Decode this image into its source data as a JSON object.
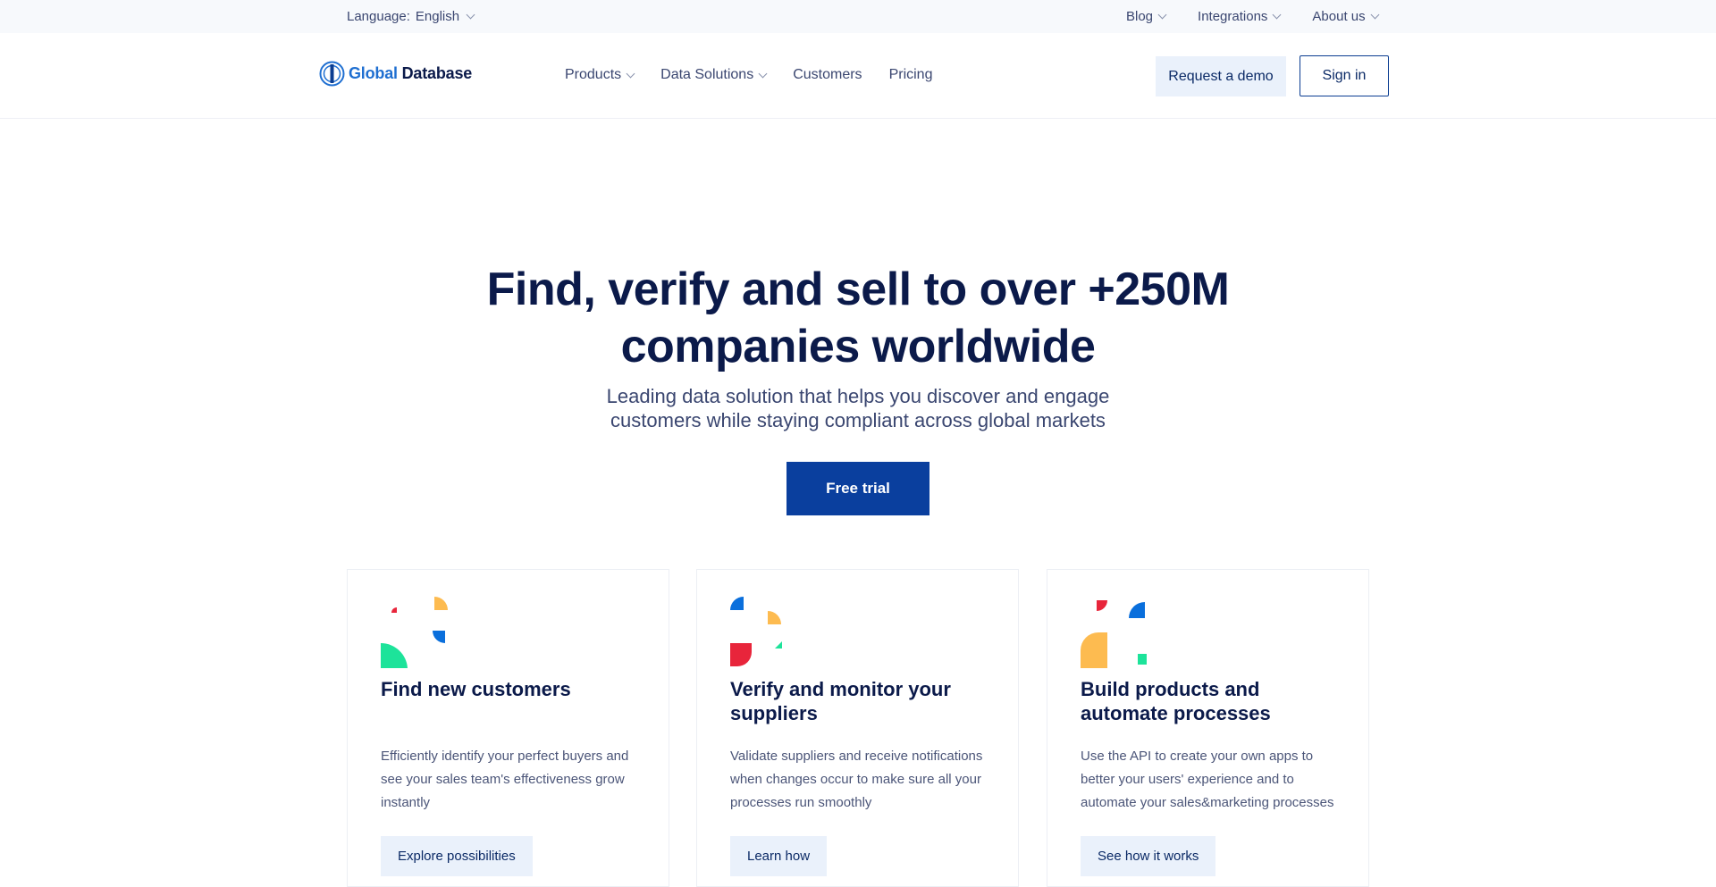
{
  "topbar": {
    "language_label": "Language:",
    "language_value": "English",
    "links": [
      "Blog",
      "Integrations",
      "About us"
    ]
  },
  "navbar": {
    "logo_global": "Global",
    "logo_database": "Database",
    "nav": [
      "Products",
      "Data Solutions",
      "Customers",
      "Pricing"
    ],
    "demo_label": "Request a demo",
    "signin_label": "Sign in"
  },
  "hero": {
    "title_line1": "Find, verify and sell to over +250M",
    "title_line2": "companies worldwide",
    "subtitle_line1": "Leading data solution that helps you discover and engage",
    "subtitle_line2": "customers while staying compliant across global markets",
    "trial_label": "Free trial"
  },
  "cards": [
    {
      "title": "Find new customers",
      "description": "Efficiently identify your perfect buyers and see your sales team's effectiveness grow instantly",
      "cta": "Explore possibilities"
    },
    {
      "title": "Verify and monitor your suppliers",
      "description": "Validate suppliers and receive notifications when changes occur to make sure all your processes run smoothly",
      "cta": "Learn how"
    },
    {
      "title": "Build products and automate processes",
      "description": "Use the API to create your own apps to better your users' experience and to automate your sales&marketing processes",
      "cta": "See how it works"
    }
  ],
  "colors": {
    "brand_blue": "#0a3f9e",
    "navy_text": "#0b1a4a",
    "light_button": "#eaf1fb",
    "shape_red": "#e8253b",
    "shape_yellow": "#fdbb50",
    "shape_blue": "#0a6fdc",
    "shape_green": "#1de39a"
  }
}
